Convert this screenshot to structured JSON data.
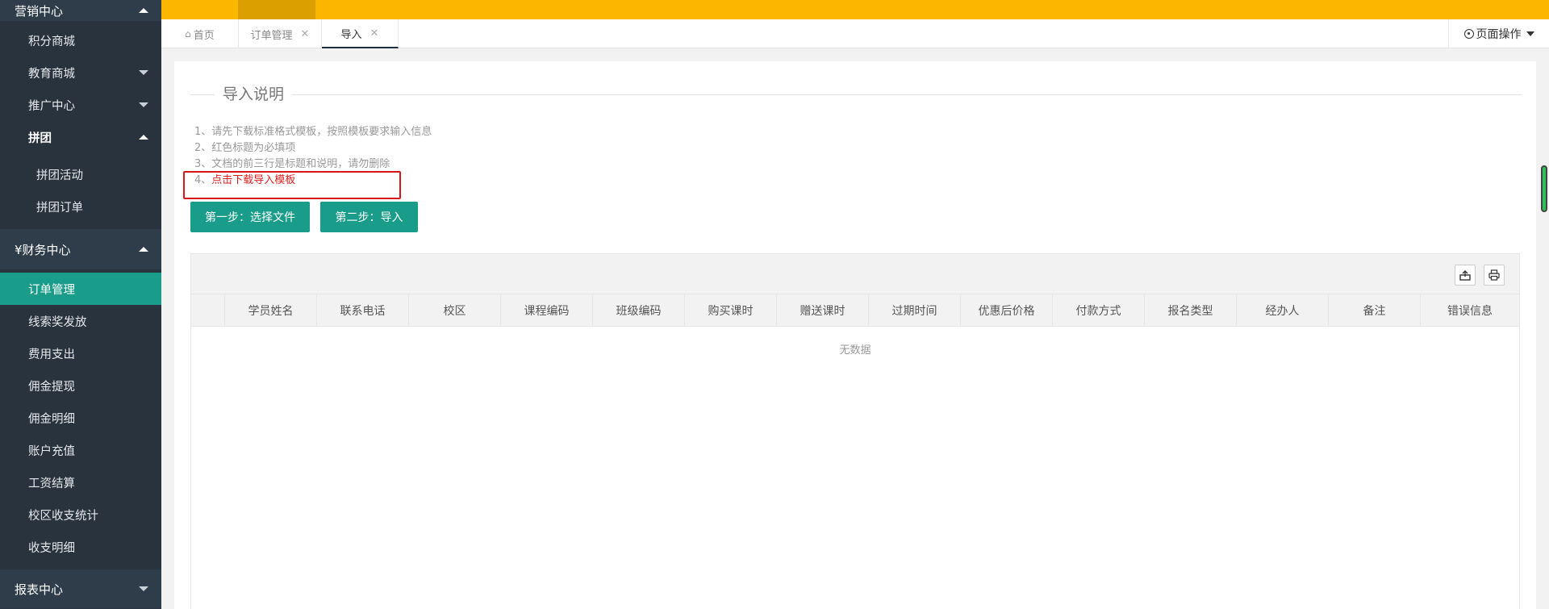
{
  "sidebar": {
    "top_group": "营销中心",
    "items": [
      {
        "label": "积分商城"
      },
      {
        "label": "教育商城"
      },
      {
        "label": "推广中心"
      },
      {
        "label": "拼团"
      },
      {
        "label": "拼团活动"
      },
      {
        "label": "拼团订单"
      }
    ],
    "finance_group": "¥财务中心",
    "finance_items": [
      {
        "label": "订单管理"
      },
      {
        "label": "线索奖发放"
      },
      {
        "label": "费用支出"
      },
      {
        "label": "佣金提现"
      },
      {
        "label": "佣金明细"
      },
      {
        "label": "账户充值"
      },
      {
        "label": "工资结算"
      },
      {
        "label": "校区收支统计"
      },
      {
        "label": "收支明细"
      }
    ],
    "bottom_group": "报表中心"
  },
  "tabs": [
    {
      "label": "首页"
    },
    {
      "label": "订单管理"
    },
    {
      "label": "导入"
    }
  ],
  "page_ops": "页面操作",
  "section_title": "导入说明",
  "instructions": [
    "1、请先下载标准格式模板，按照模板要求输入信息",
    "2、红色标题为必填项",
    "3、文档的前三行是标题和说明，请勿删除"
  ],
  "instruction_4_prefix": "4、",
  "instruction_4_link": "点击下载导入模板",
  "buttons": {
    "step1": "第一步：选择文件",
    "step2": "第二步：导入"
  },
  "table": {
    "columns": [
      "学员姓名",
      "联系电话",
      "校区",
      "课程编码",
      "班级编码",
      "购买课时",
      "赠送课时",
      "过期时间",
      "优惠后价格",
      "付款方式",
      "报名类型",
      "经办人",
      "备注",
      "错误信息"
    ],
    "empty_text": "无数据"
  },
  "colors": {
    "topbar": "#fbb700",
    "sidebar": "#28333e",
    "accent": "#199d8a",
    "required_red": "#e02020"
  }
}
